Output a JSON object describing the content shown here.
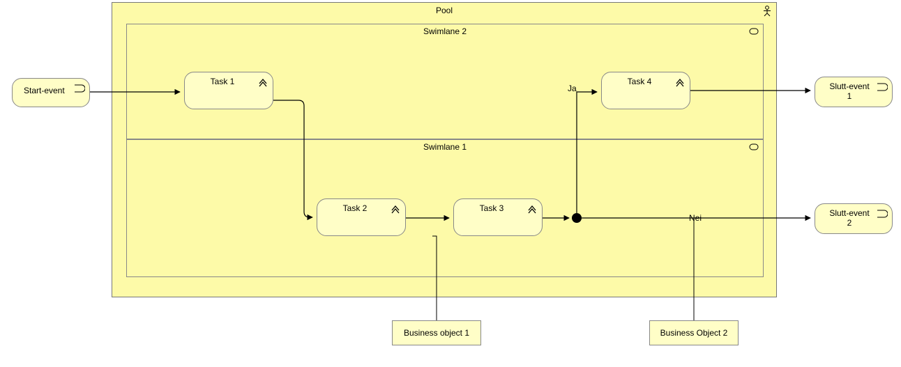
{
  "diagram": {
    "pool": {
      "title": "Pool",
      "lanes": {
        "top": {
          "title": "Swimlane 2"
        },
        "bottom": {
          "title": "Swimlane 1"
        }
      }
    },
    "nodes": {
      "startEvent": {
        "label": "Start-event",
        "kind": "event"
      },
      "task1": {
        "label": "Task 1",
        "kind": "task"
      },
      "task2": {
        "label": "Task 2",
        "kind": "task"
      },
      "task3": {
        "label": "Task 3",
        "kind": "task"
      },
      "task4": {
        "label": "Task 4",
        "kind": "task"
      },
      "sluttEvent1": {
        "label": "Slutt-event 1",
        "kind": "event"
      },
      "sluttEvent2": {
        "label": "Slutt-event 2",
        "kind": "event"
      },
      "bo1": {
        "label": "Business object 1",
        "kind": "business-object"
      },
      "bo2": {
        "label": "Business Object 2",
        "kind": "business-object"
      },
      "gateway": {
        "kind": "junction"
      }
    },
    "flows": {
      "ja": {
        "label": "Ja"
      },
      "nei": {
        "label": "Nei"
      }
    },
    "icons": {
      "taskMarker": "chevron",
      "eventMarker": "event-circle",
      "laneMarker": "role-rect",
      "poolMarker": "actor"
    }
  }
}
